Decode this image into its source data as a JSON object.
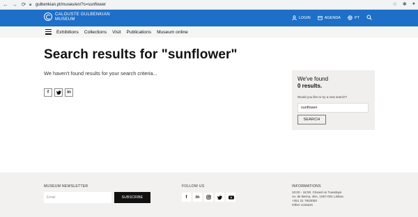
{
  "browser": {
    "url": "gulbenkian.pt/museu/en/?s=sunflower",
    "icons": [
      "back-arrow",
      "forward-arrow",
      "reload",
      "star",
      "extensions",
      "profile"
    ]
  },
  "header": {
    "logo_line1": "CALOUSTE GULBENKIAN",
    "logo_line2": "MUSEUM",
    "login": "LOGIN",
    "agenda": "AGENDA",
    "language": "PT",
    "accent_color": "#1d6fc8"
  },
  "subnav": {
    "items": [
      "Exhibitions",
      "Collections",
      "Visit",
      "Publications",
      "Museum online"
    ]
  },
  "main": {
    "title": "Search results for \"sunflower\"",
    "no_results": "We haven't found results for your search criteria...",
    "share": [
      "f",
      "t",
      "in"
    ]
  },
  "sidebox": {
    "found": "We've found",
    "count": "0 results.",
    "question": "Would you like to try a new search?",
    "search_value": "sunflower",
    "search_button": "SEARCH"
  },
  "footer": {
    "newsletter_heading": "MUSEUM NEWSLETTER",
    "email_placeholder": "Email",
    "subscribe": "SUBSCRIBE",
    "follow_heading": "FOLLOW US",
    "social": [
      "f",
      "in",
      "ig",
      "tw",
      "yt"
    ],
    "info_heading": "INFORMATIONS",
    "info_lines": [
      "10:00 - 18:00. Closed on Tuesdays",
      "Av. de Berna, 45A, 1067-001 Lisboa",
      "+351 21 7823000",
      "Other contacts"
    ]
  }
}
